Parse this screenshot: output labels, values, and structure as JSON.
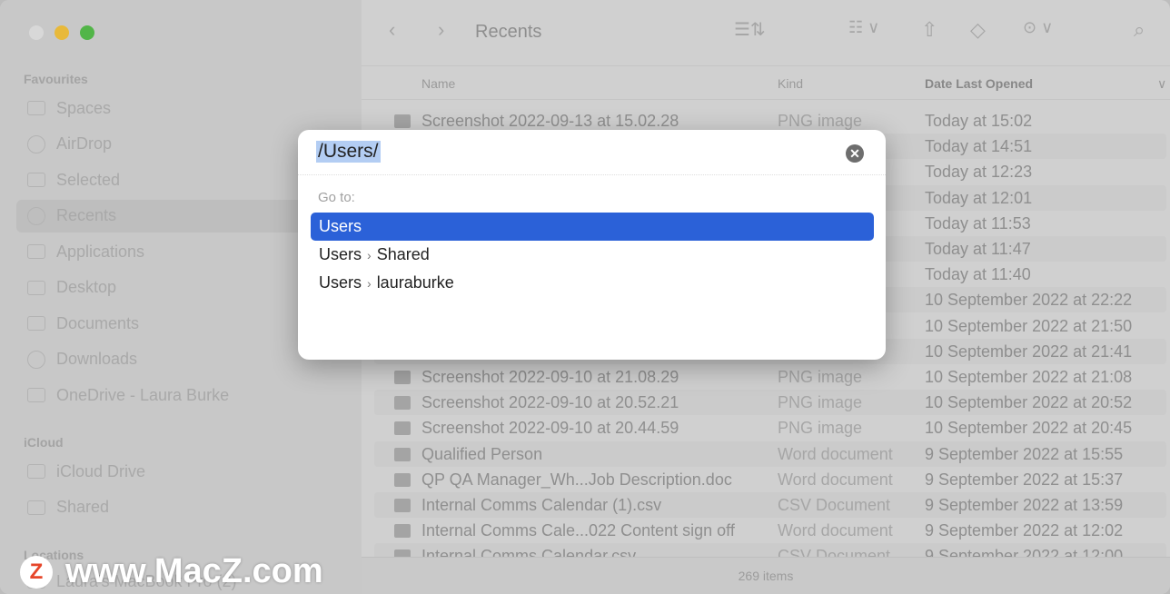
{
  "sidebar": {
    "sections": [
      "Favourites",
      "iCloud",
      "Locations"
    ],
    "favourites": [
      "Spaces",
      "AirDrop",
      "Selected",
      "Recents",
      "Applications",
      "Desktop",
      "Documents",
      "Downloads",
      "OneDrive - Laura Burke"
    ],
    "icloud": [
      "iCloud Drive",
      "Shared"
    ],
    "locations": [
      "Laura's MacBook Pro (2)"
    ],
    "selected": "Recents"
  },
  "toolbar": {
    "title": "Recents"
  },
  "columns": {
    "name": "Name",
    "kind": "Kind",
    "date": "Date Last Opened"
  },
  "rows": [
    {
      "name": "Screenshot 2022-09-13 at 15.02.28",
      "kind": "PNG image",
      "date": "Today at 15:02"
    },
    {
      "name": "",
      "kind": "",
      "date": "Today at 14:51"
    },
    {
      "name": "",
      "kind": "",
      "date": "Today at 12:23"
    },
    {
      "name": "",
      "kind": "",
      "date": "Today at 12:01"
    },
    {
      "name": "",
      "kind": "",
      "date": "Today at 11:53"
    },
    {
      "name": "",
      "kind": "",
      "date": "Today at 11:47"
    },
    {
      "name": "",
      "kind": "",
      "date": "Today at 11:40"
    },
    {
      "name": "",
      "kind": "",
      "date": "10 September 2022 at 22:22"
    },
    {
      "name": "",
      "kind": "",
      "date": "10 September 2022 at 21:50"
    },
    {
      "name": "",
      "kind": "",
      "date": "10 September 2022 at 21:41"
    },
    {
      "name": "Screenshot 2022-09-10 at 21.08.29",
      "kind": "PNG image",
      "date": "10 September 2022 at 21:08"
    },
    {
      "name": "Screenshot 2022-09-10 at 20.52.21",
      "kind": "PNG image",
      "date": "10 September 2022 at 20:52"
    },
    {
      "name": "Screenshot 2022-09-10 at 20.44.59",
      "kind": "PNG image",
      "date": "10 September 2022 at 20:45"
    },
    {
      "name": "Qualified Person",
      "kind": "Word document",
      "date": "9 September 2022 at 15:55"
    },
    {
      "name": "QP QA Manager_Wh...Job Description.doc",
      "kind": "Word document",
      "date": "9 September 2022 at 15:37"
    },
    {
      "name": "Internal Comms Calendar (1).csv",
      "kind": "CSV Document",
      "date": "9 September 2022 at 13:59"
    },
    {
      "name": "Internal Comms Cale...022 Content sign off",
      "kind": "Word document",
      "date": "9 September 2022 at 12:02"
    },
    {
      "name": "Internal Comms Calendar.csv",
      "kind": "CSV Document",
      "date": "9 September 2022 at 12:00"
    }
  ],
  "status": "269 items",
  "dialog": {
    "path": "/Users/",
    "goto_label": "Go to:",
    "options": [
      [
        "Users"
      ],
      [
        "Users",
        "Shared"
      ],
      [
        "Users",
        "lauraburke"
      ]
    ],
    "accent": "#2b61d8"
  },
  "watermark": "www.MacZ.com"
}
